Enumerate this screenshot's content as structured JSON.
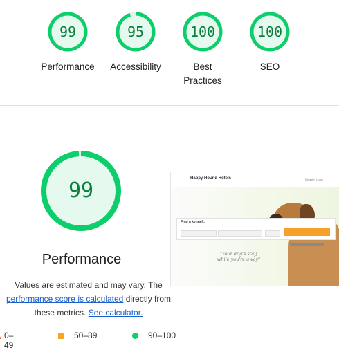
{
  "summary_gauges": [
    {
      "score": "99",
      "label": "Performance"
    },
    {
      "score": "95",
      "label": "Accessibility"
    },
    {
      "score": "100",
      "label": "Best Practices"
    },
    {
      "score": "100",
      "label": "SEO"
    }
  ],
  "performance": {
    "score": "99",
    "title": "Performance",
    "desc_part1": "Values are estimated and may vary. The ",
    "link1": "performance score is calculated",
    "desc_part2": " directly from these metrics. ",
    "link2": "See calculator.",
    "colors": {
      "pass": "#0cce6b",
      "average": "#f5a623",
      "fail": "#ff4e42",
      "text_pass": "#0a7d3f"
    }
  },
  "legend": [
    {
      "range": "0–49",
      "shape": "triangle"
    },
    {
      "range": "50–89",
      "shape": "square"
    },
    {
      "range": "90–100",
      "shape": "circle"
    }
  ],
  "screenshot": {
    "logo": "Happy Hound Hotels",
    "nav": "Register  Login",
    "find_label": "Find a kennel...",
    "quote_line1": "\"Your dog's stay,",
    "quote_line2": "while you're away\""
  }
}
